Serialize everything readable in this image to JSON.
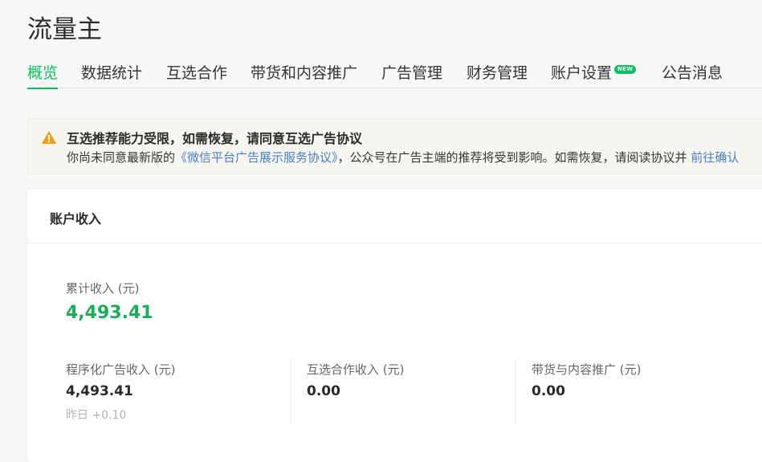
{
  "app": {
    "title": "流量主"
  },
  "tabs": [
    {
      "label": "概览",
      "active": true
    },
    {
      "label": "数据统计"
    },
    {
      "label": "互选合作"
    },
    {
      "label": "带货和内容推广"
    },
    {
      "label": "广告管理"
    },
    {
      "label": "财务管理"
    },
    {
      "label": "账户设置",
      "badge": "NEW"
    },
    {
      "label": "公告消息"
    }
  ],
  "notice": {
    "title": "互选推荐能力受限，如需恢复，请同意互选广告协议",
    "body_prefix": "你尚未同意最新版的",
    "agreement_link": "《微信平台广告展示服务协议》",
    "body_middle": "，公众号在广告主端的推荐将受到影响。如需恢复，请阅读协议并",
    "confirm_link": "前往确认"
  },
  "income": {
    "title": "账户收入",
    "total_label": "累计收入 (元)",
    "total_value": "4,493.41",
    "metrics": [
      {
        "label": "程序化广告收入 (元)",
        "value": "4,493.41",
        "sub": "昨日 +0.10"
      },
      {
        "label": "互选合作收入 (元)",
        "value": "0.00"
      },
      {
        "label": "带货与内容推广 (元)",
        "value": "0.00"
      }
    ]
  },
  "colors": {
    "accent": "#07c160",
    "warning": "#f0a010",
    "link": "#4a7fc1"
  }
}
